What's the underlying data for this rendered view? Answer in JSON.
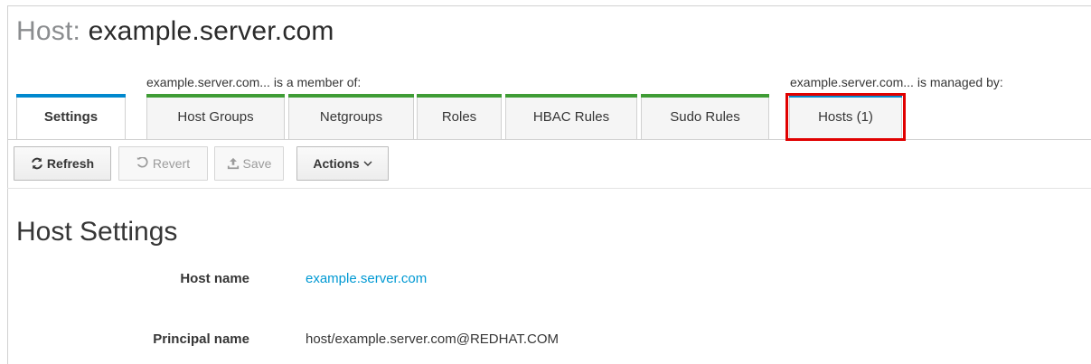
{
  "header": {
    "title_prefix": "Host: ",
    "title_name": "example.server.com"
  },
  "groups": {
    "member_of_label": "example.server.com... is a member of:",
    "managed_by_label": "example.server.com... is managed by:"
  },
  "tabs": [
    {
      "label": "Settings",
      "color": "blue",
      "active": true
    },
    {
      "label": "Host Groups",
      "color": "green"
    },
    {
      "label": "Netgroups",
      "color": "green"
    },
    {
      "label": "Roles",
      "color": "green"
    },
    {
      "label": "HBAC Rules",
      "color": "green"
    },
    {
      "label": "Sudo Rules",
      "color": "green"
    },
    {
      "label": "Hosts (1)",
      "color": "blue"
    }
  ],
  "toolbar": {
    "refresh_label": "Refresh",
    "revert_label": "Revert",
    "save_label": "Save",
    "actions_label": "Actions"
  },
  "settings": {
    "section_title": "Host Settings",
    "host_name_label": "Host name",
    "host_name_value": "example.server.com",
    "principal_name_label": "Principal name",
    "principal_name_value": "host/example.server.com@REDHAT.COM"
  },
  "colors": {
    "accent_blue": "#0088ce",
    "accent_green": "#3f9c35",
    "highlight_red": "#e00000",
    "link": "#0099d3"
  },
  "icons": {
    "refresh": "refresh-icon",
    "revert": "undo-icon",
    "save": "upload-icon",
    "actions": "chevron-down-icon"
  }
}
